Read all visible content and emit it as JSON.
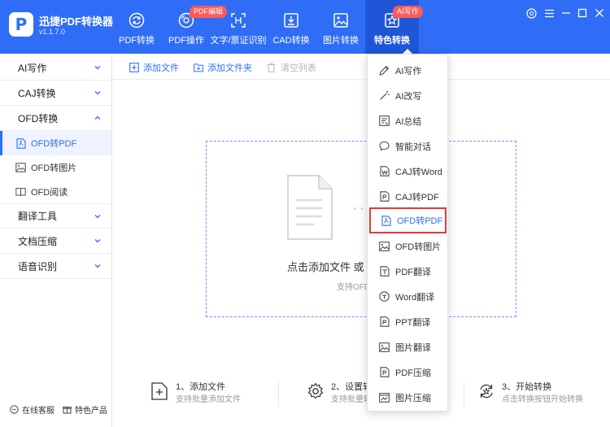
{
  "app": {
    "name": "迅捷PDF转换器",
    "version": "v1.1.7.0",
    "logo_letter": "P"
  },
  "colors": {
    "brand": "#2f6df6",
    "active_tab": "#1f56d8",
    "badge": "#ff5a5a",
    "highlight_border": "#e53935"
  },
  "nav": {
    "tabs": [
      {
        "label": "PDF转换",
        "icon": "refresh-icon"
      },
      {
        "label": "PDF操作",
        "icon": "disc-icon",
        "badge": "PDF编辑"
      },
      {
        "label": "文字/票证识别",
        "icon": "scan-icon"
      },
      {
        "label": "CAD转换",
        "icon": "cad-icon"
      },
      {
        "label": "图片转换",
        "icon": "image-icon"
      },
      {
        "label": "特色转换",
        "icon": "star-icon",
        "badge": "AI写作",
        "active": true
      }
    ]
  },
  "window": {
    "buttons": [
      "settings-icon",
      "menu-icon",
      "minimize-icon",
      "maximize-icon",
      "close-icon"
    ]
  },
  "sidebar": {
    "categories": [
      {
        "label": "AI写作"
      },
      {
        "label": "CAJ转换"
      },
      {
        "label": "OFD转换",
        "expanded": true,
        "items": [
          {
            "label": "OFD转PDF",
            "active": true
          },
          {
            "label": "OFD转图片"
          },
          {
            "label": "OFD阅读"
          }
        ]
      },
      {
        "label": "翻译工具"
      },
      {
        "label": "文档压缩"
      },
      {
        "label": "语音识别"
      }
    ],
    "footer": {
      "support": "在线客服",
      "products": "特色产品"
    }
  },
  "toolbar": {
    "add_file": "添加文件",
    "add_folder": "添加文件夹",
    "clear_list": "清空列表"
  },
  "dropzone": {
    "text": "点击添加文件 或 拖",
    "subtext": "支持OFD"
  },
  "steps": [
    {
      "title": "1、添加文件",
      "desc": "支持批量添加文件"
    },
    {
      "title": "2、设置转",
      "desc": "支持批量转"
    },
    {
      "title": "3、开始转换",
      "desc": "点击转换按钮开始转换"
    }
  ],
  "dropdown": {
    "items": [
      {
        "label": "AI写作",
        "icon": "pen-icon"
      },
      {
        "label": "AI改写",
        "icon": "wand-icon"
      },
      {
        "label": "AI总结",
        "icon": "summary-icon"
      },
      {
        "label": "智能对话",
        "icon": "chat-icon"
      },
      {
        "label": "CAJ转Word",
        "icon": "word-icon"
      },
      {
        "label": "CAJ转PDF",
        "icon": "pdf-icon"
      },
      {
        "label": "OFD转PDF",
        "icon": "pdf-icon",
        "highlighted": true
      },
      {
        "label": "OFD转图片",
        "icon": "image-icon"
      },
      {
        "label": "PDF翻译",
        "icon": "translate-icon"
      },
      {
        "label": "Word翻译",
        "icon": "translate-icon"
      },
      {
        "label": "PPT翻译",
        "icon": "ppt-icon"
      },
      {
        "label": "图片翻译",
        "icon": "image-icon"
      },
      {
        "label": "PDF压缩",
        "icon": "compress-icon"
      },
      {
        "label": "图片压缩",
        "icon": "compress-image-icon"
      }
    ]
  }
}
